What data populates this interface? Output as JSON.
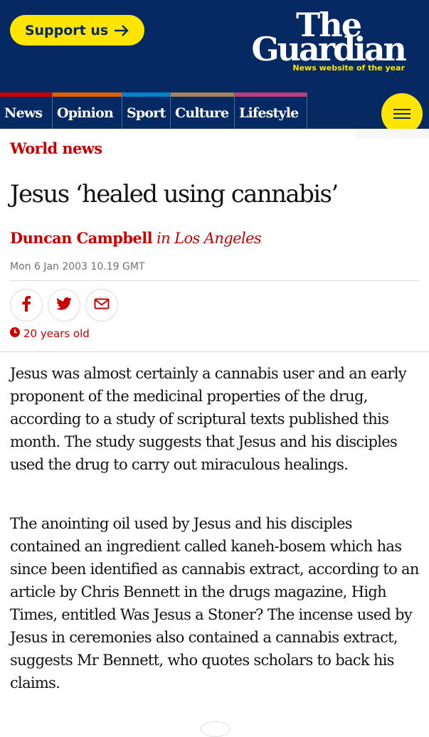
{
  "header": {
    "support_label": "Support us",
    "logo_line1": "The",
    "logo_line2": "Guardian",
    "tagline": "News website of the year"
  },
  "nav": {
    "items": [
      {
        "label": "News",
        "color": "#c70000"
      },
      {
        "label": "Opinion",
        "color": "#e05e00"
      },
      {
        "label": "Sport",
        "color": "#0084c6"
      },
      {
        "label": "Culture",
        "color": "#a1845c"
      },
      {
        "label": "Lifestyle",
        "color": "#bb3b80"
      }
    ],
    "menu_icon": "hamburger-icon"
  },
  "article": {
    "section": "World news",
    "headline": "Jesus ‘healed using cannabis’",
    "author": "Duncan Campbell",
    "location": "in Los Angeles",
    "date": "Mon 6 Jan 2003 10.19 GMT",
    "share_icons": [
      "facebook-icon",
      "twitter-icon",
      "email-icon"
    ],
    "age": "20 years old",
    "paragraphs": [
      "Jesus was almost certainly a cannabis user and an early proponent of the medicinal properties of the drug, according to a study of scriptural texts published this month. The study suggests that Jesus and his disciples used the drug to carry out miraculous healings.",
      "The anointing oil used by Jesus and his disciples contained an ingredient called kaneh-bosem which has since been identified as cannabis extract, according to an article by Chris Bennett in the drugs magazine, High Times, entitled Was Jesus a Stoner? The incense used by Jesus in ceremonies also contained a cannabis extract, suggests Mr Bennett, who quotes scholars to back his claims."
    ]
  },
  "colors": {
    "brand_blue": "#052962",
    "accent_yellow": "#ffe500",
    "news_red": "#c70000"
  }
}
